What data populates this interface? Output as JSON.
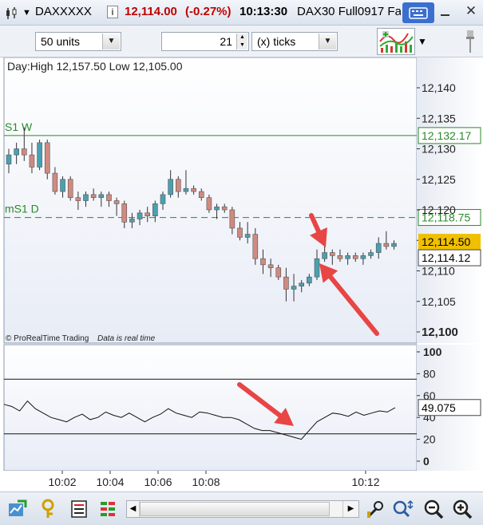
{
  "titlebar": {
    "instrument": "DAXXXXX",
    "last_price": "12,114.00",
    "change": "(-0.27%)",
    "time": "10:13:30",
    "description": "DAX30 Full0917 Fa",
    "price_color": "#c00000"
  },
  "toolbar": {
    "units_value": "50 units",
    "ticks_count": "21",
    "ticks_mode": "(x) ticks"
  },
  "chart": {
    "info_label": "Day:High 12,157.50 Low 12,105.00",
    "copyright": "© ProRealTime Trading",
    "realtime_note": "Data is real time",
    "level_s1w_label": "S1 W",
    "level_s1w_value": "12,132.17",
    "level_ms1d_label": "mS1 D",
    "level_ms1d_value": "12,118.75",
    "last_price_tag": "12,114.50",
    "cursor_price_tag": "12,114.12",
    "indicator_value": "49.075",
    "colors": {
      "bull": "#4aa0b0",
      "bear": "#d08a80",
      "level": "#2a8a2a",
      "arrow": "#e84545",
      "last_tag": "#f0c000"
    }
  },
  "chart_data": [
    {
      "type": "candlestick",
      "ylim": [
        12098,
        12145
      ],
      "y_ticks": [
        "12,100",
        "12,105",
        "12,110",
        "12,115",
        "12,120",
        "12,125",
        "12,130",
        "12,135",
        "12,140"
      ],
      "x_ticks": [
        "10:02",
        "10:04",
        "10:06",
        "10:08",
        "10:12"
      ],
      "candles": [
        {
          "o": 12127.5,
          "h": 12130.0,
          "l": 12126.0,
          "c": 12129.0
        },
        {
          "o": 12129.0,
          "h": 12131.0,
          "l": 12127.5,
          "c": 12130.0
        },
        {
          "o": 12130.0,
          "h": 12133.5,
          "l": 12128.0,
          "c": 12129.0
        },
        {
          "o": 12129.0,
          "h": 12131.0,
          "l": 12126.0,
          "c": 12127.0
        },
        {
          "o": 12127.0,
          "h": 12131.5,
          "l": 12126.5,
          "c": 12131.0
        },
        {
          "o": 12131.0,
          "h": 12131.5,
          "l": 12125.0,
          "c": 12126.0
        },
        {
          "o": 12126.0,
          "h": 12127.0,
          "l": 12122.5,
          "c": 12123.0
        },
        {
          "o": 12123.0,
          "h": 12125.5,
          "l": 12122.0,
          "c": 12125.0
        },
        {
          "o": 12125.0,
          "h": 12125.5,
          "l": 12121.5,
          "c": 12122.0
        },
        {
          "o": 12122.0,
          "h": 12123.0,
          "l": 12120.0,
          "c": 12121.5
        },
        {
          "o": 12121.5,
          "h": 12123.0,
          "l": 12120.5,
          "c": 12122.5
        },
        {
          "o": 12122.5,
          "h": 12123.5,
          "l": 12121.5,
          "c": 12122.0
        },
        {
          "o": 12122.0,
          "h": 12123.0,
          "l": 12120.5,
          "c": 12122.5
        },
        {
          "o": 12122.5,
          "h": 12123.0,
          "l": 12120.5,
          "c": 12121.5
        },
        {
          "o": 12121.5,
          "h": 12122.0,
          "l": 12119.0,
          "c": 12121.0
        },
        {
          "o": 12121.0,
          "h": 12121.5,
          "l": 12117.0,
          "c": 12118.0
        },
        {
          "o": 12118.0,
          "h": 12119.5,
          "l": 12117.0,
          "c": 12118.5
        },
        {
          "o": 12118.5,
          "h": 12120.0,
          "l": 12117.5,
          "c": 12119.5
        },
        {
          "o": 12119.5,
          "h": 12120.5,
          "l": 12118.0,
          "c": 12119.0
        },
        {
          "o": 12119.0,
          "h": 12121.5,
          "l": 12118.0,
          "c": 12121.0
        },
        {
          "o": 12121.0,
          "h": 12123.0,
          "l": 12120.0,
          "c": 12122.5
        },
        {
          "o": 12122.5,
          "h": 12126.5,
          "l": 12122.0,
          "c": 12125.0
        },
        {
          "o": 12125.0,
          "h": 12125.5,
          "l": 12122.0,
          "c": 12123.0
        },
        {
          "o": 12123.0,
          "h": 12126.5,
          "l": 12122.5,
          "c": 12123.5
        },
        {
          "o": 12123.5,
          "h": 12124.0,
          "l": 12122.5,
          "c": 12123.0
        },
        {
          "o": 12123.0,
          "h": 12123.5,
          "l": 12121.5,
          "c": 12122.0
        },
        {
          "o": 12122.0,
          "h": 12122.5,
          "l": 12119.5,
          "c": 12120.0
        },
        {
          "o": 12120.0,
          "h": 12121.0,
          "l": 12118.5,
          "c": 12120.5
        },
        {
          "o": 12120.5,
          "h": 12121.0,
          "l": 12119.5,
          "c": 12120.0
        },
        {
          "o": 12120.0,
          "h": 12120.5,
          "l": 12116.0,
          "c": 12117.0
        },
        {
          "o": 12117.0,
          "h": 12118.0,
          "l": 12115.0,
          "c": 12115.5
        },
        {
          "o": 12115.5,
          "h": 12118.0,
          "l": 12114.5,
          "c": 12116.0
        },
        {
          "o": 12116.0,
          "h": 12117.0,
          "l": 12111.0,
          "c": 12112.0
        },
        {
          "o": 12112.0,
          "h": 12113.5,
          "l": 12109.5,
          "c": 12111.0
        },
        {
          "o": 12111.0,
          "h": 12112.0,
          "l": 12109.0,
          "c": 12110.5
        },
        {
          "o": 12110.5,
          "h": 12111.0,
          "l": 12108.5,
          "c": 12109.0
        },
        {
          "o": 12109.0,
          "h": 12110.5,
          "l": 12105.0,
          "c": 12107.0
        },
        {
          "o": 12107.0,
          "h": 12109.5,
          "l": 12105.0,
          "c": 12107.5
        },
        {
          "o": 12107.5,
          "h": 12108.5,
          "l": 12106.5,
          "c": 12108.0
        },
        {
          "o": 12108.0,
          "h": 12109.5,
          "l": 12107.5,
          "c": 12109.0
        },
        {
          "o": 12109.0,
          "h": 12113.5,
          "l": 12108.5,
          "c": 12112.0
        },
        {
          "o": 12112.0,
          "h": 12114.5,
          "l": 12111.5,
          "c": 12113.0
        },
        {
          "o": 12113.0,
          "h": 12113.5,
          "l": 12111.0,
          "c": 12112.5
        },
        {
          "o": 12112.5,
          "h": 12113.5,
          "l": 12111.5,
          "c": 12112.0
        },
        {
          "o": 12112.0,
          "h": 12113.0,
          "l": 12111.0,
          "c": 12112.5
        },
        {
          "o": 12112.5,
          "h": 12113.0,
          "l": 12111.5,
          "c": 12112.0
        },
        {
          "o": 12112.0,
          "h": 12113.0,
          "l": 12111.0,
          "c": 12112.5
        },
        {
          "o": 12112.5,
          "h": 12113.5,
          "l": 12112.0,
          "c": 12113.0
        },
        {
          "o": 12113.0,
          "h": 12115.5,
          "l": 12112.0,
          "c": 12114.5
        },
        {
          "o": 12114.5,
          "h": 12116.5,
          "l": 12113.5,
          "c": 12114.0
        },
        {
          "o": 12114.0,
          "h": 12115.0,
          "l": 12113.5,
          "c": 12114.5
        }
      ],
      "levels": [
        {
          "label": "S1 W",
          "value": 12132.17,
          "style": "solid"
        },
        {
          "label": "mS1 D",
          "value": 12118.75,
          "style": "dashed"
        }
      ]
    },
    {
      "type": "line",
      "ylim": [
        -5,
        105
      ],
      "y_ticks": [
        "100",
        "80",
        "60",
        "40",
        "20",
        "0"
      ],
      "reference_lines": [
        75,
        25
      ],
      "values": [
        52,
        50,
        46,
        55,
        48,
        44,
        40,
        38,
        36,
        40,
        43,
        38,
        40,
        45,
        42,
        40,
        44,
        40,
        36,
        40,
        43,
        48,
        44,
        42,
        40,
        45,
        44,
        42,
        40,
        40,
        38,
        34,
        30,
        28,
        28,
        26,
        24,
        22,
        20,
        28,
        36,
        40,
        44,
        43,
        41,
        45,
        42,
        44,
        46,
        45,
        49
      ]
    }
  ],
  "bottombar": {
    "icons": [
      "chart-type-icon",
      "indicator-icon",
      "drawing-list-icon",
      "properties-icon",
      "tools-icon",
      "auto-scale-icon",
      "zoom-out-icon",
      "zoom-in-icon"
    ]
  }
}
